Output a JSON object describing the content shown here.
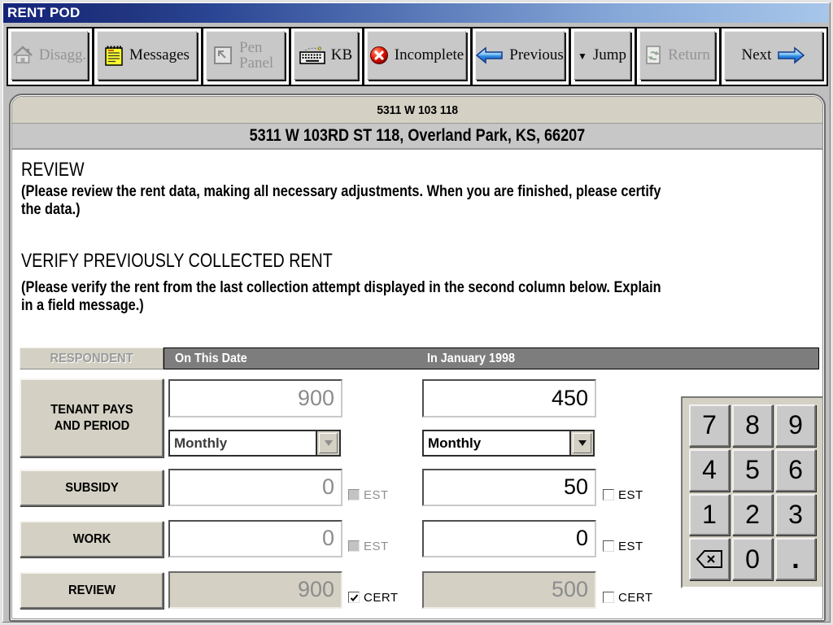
{
  "window": {
    "title": "RENT POD"
  },
  "toolbar": {
    "buttons": [
      {
        "label": "Disagg.",
        "icon": "home",
        "disabled": true
      },
      {
        "label": "Messages",
        "icon": "notepad",
        "disabled": false
      },
      {
        "label": "Pen Panel",
        "icon": "pen-panel",
        "disabled": true
      },
      {
        "label": "KB",
        "icon": "keyboard",
        "disabled": false
      },
      {
        "label": "Incomplete",
        "icon": "red-x-circle",
        "disabled": false
      },
      {
        "label": "Previous",
        "icon": "arrow-left",
        "disabled": false
      },
      {
        "label": "Jump",
        "caret": "▼",
        "disabled": false
      },
      {
        "label": "Return",
        "icon": "return-doc",
        "disabled": true
      },
      {
        "label": "Next",
        "icon": "arrow-right",
        "disabled": false
      }
    ]
  },
  "header": {
    "case_line": "5311 W 103 118",
    "address_line": "5311 W 103RD ST 118, Overland Park, KS, 66207"
  },
  "sections": {
    "review": {
      "title": "REVIEW",
      "lines": [
        "(Please review the rent data, making all necessary adjustments. When you are finished, please certify",
        "the data.)"
      ]
    },
    "verify": {
      "title": "VERIFY PREVIOUSLY COLLECTED RENT",
      "lines": [
        "(Please verify the rent from the last collection attempt displayed in the second column below. Explain",
        "in a field message.)"
      ]
    }
  },
  "grid": {
    "corner_label": "RESPONDENT",
    "col1_header": "On This Date",
    "col2_header": "In January 1998",
    "est_label": "EST",
    "cert_label": "CERT",
    "rows": {
      "tenant": {
        "label": "TENANT PAYS AND PERIOD",
        "col1": {
          "value": "900",
          "period": "Monthly",
          "disabled": true
        },
        "col2": {
          "value": "450",
          "period": "Monthly",
          "disabled": false
        }
      },
      "subsidy": {
        "label": "SUBSIDY",
        "col1": {
          "value": "0",
          "est_checked": false,
          "disabled": true
        },
        "col2": {
          "value": "50",
          "est_checked": false,
          "disabled": false
        }
      },
      "work": {
        "label": "WORK",
        "col1": {
          "value": "0",
          "est_checked": false,
          "disabled": true
        },
        "col2": {
          "value": "0",
          "est_checked": false,
          "disabled": false
        }
      },
      "review": {
        "label": "REVIEW",
        "col1": {
          "value": "900",
          "cert_checked": true,
          "readonly": true
        },
        "col2": {
          "value": "500",
          "cert_checked": false,
          "readonly": true
        }
      }
    }
  },
  "keypad": {
    "keys": [
      "7",
      "8",
      "9",
      "4",
      "5",
      "6",
      "1",
      "2",
      "3",
      "0",
      "."
    ]
  }
}
